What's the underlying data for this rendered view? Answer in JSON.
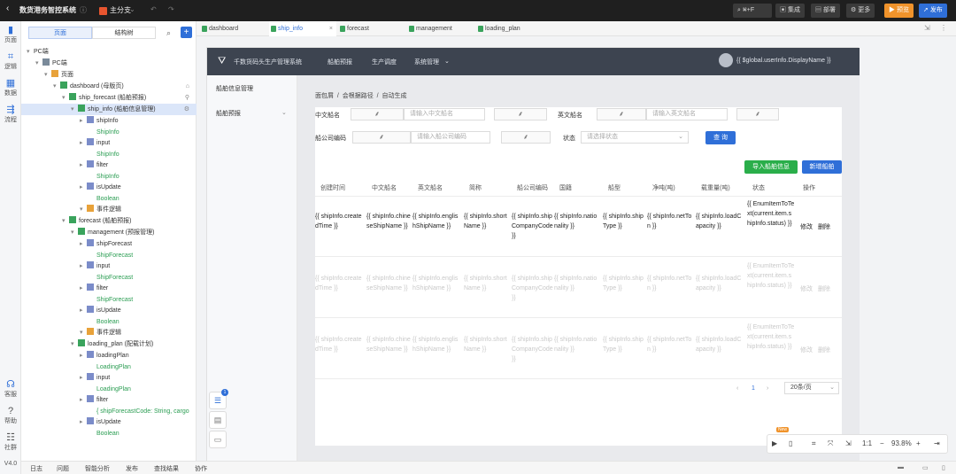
{
  "topbar": {
    "back_icon": "chevron-left-icon",
    "title": "数货港务智控系统",
    "branch_label": "主分支",
    "search_placeholder": "⌘+F",
    "btn_integrate": "集成",
    "btn_deploy": "部署",
    "btn_more": "更多",
    "btn_preview": "预览",
    "btn_publish": "发布"
  },
  "rail": {
    "items": [
      {
        "label": "页面",
        "icon": "page-icon"
      },
      {
        "label": "逻辑",
        "icon": "logic-icon"
      },
      {
        "label": "数据",
        "icon": "data-icon"
      },
      {
        "label": "流程",
        "icon": "flow-icon"
      }
    ],
    "bottom": [
      {
        "label": "客服",
        "icon": "support-icon"
      },
      {
        "label": "帮助",
        "icon": "help-icon"
      },
      {
        "label": "社群",
        "icon": "community-icon"
      }
    ],
    "version": "V4.0"
  },
  "tree": {
    "tab_pages": "页面",
    "tab_structure": "结构树",
    "nodes": [
      {
        "label": "PC端",
        "sub": "",
        "indent": 0,
        "kind": "none",
        "sel": false
      },
      {
        "label": "PC端",
        "sub": "",
        "indent": 1,
        "kind": "monitor",
        "sel": false
      },
      {
        "label": "页面",
        "sub": "",
        "indent": 2,
        "kind": "folder",
        "sel": false
      },
      {
        "label": "dashboard (母版页)",
        "sub": "",
        "indent": 3,
        "kind": "page",
        "sel": false
      },
      {
        "label": "ship_forecast (船舶预报)",
        "sub": "",
        "indent": 4,
        "kind": "page",
        "sel": false
      },
      {
        "label": "ship_info (船舶信息管理)",
        "sub": "",
        "indent": 5,
        "kind": "page",
        "sel": true
      },
      {
        "label": "shipInfo",
        "sub": "ShipInfo",
        "indent": 6,
        "kind": "var",
        "sel": false
      },
      {
        "label": "input",
        "sub": "ShipInfo",
        "indent": 6,
        "kind": "var",
        "sel": false
      },
      {
        "label": "filter",
        "sub": "ShipInfo",
        "indent": 6,
        "kind": "var",
        "sel": false
      },
      {
        "label": "isUpdate",
        "sub": "Boolean",
        "indent": 6,
        "kind": "var",
        "sel": false
      },
      {
        "label": "事件逻辑",
        "sub": "",
        "indent": 6,
        "kind": "folder",
        "sel": false
      },
      {
        "label": "forecast (船舶预报)",
        "sub": "",
        "indent": 4,
        "kind": "page",
        "sel": false
      },
      {
        "label": "management (预报管理)",
        "sub": "",
        "indent": 5,
        "kind": "page",
        "sel": false
      },
      {
        "label": "shipForecast",
        "sub": "ShipForecast",
        "indent": 6,
        "kind": "var",
        "sel": false
      },
      {
        "label": "input",
        "sub": "ShipForecast",
        "indent": 6,
        "kind": "var",
        "sel": false
      },
      {
        "label": "filter",
        "sub": "ShipForecast",
        "indent": 6,
        "kind": "var",
        "sel": false
      },
      {
        "label": "isUpdate",
        "sub": "Boolean",
        "indent": 6,
        "kind": "var",
        "sel": false
      },
      {
        "label": "事件逻辑",
        "sub": "",
        "indent": 6,
        "kind": "folder",
        "sel": false
      },
      {
        "label": "loading_plan (配载计划)",
        "sub": "",
        "indent": 5,
        "kind": "page",
        "sel": false
      },
      {
        "label": "loadingPlan",
        "sub": "LoadingPlan",
        "indent": 6,
        "kind": "var",
        "sel": false
      },
      {
        "label": "input",
        "sub": "LoadingPlan",
        "indent": 6,
        "kind": "var",
        "sel": false
      },
      {
        "label": "filter",
        "sub": "{ shipForecastCode: String, cargo",
        "indent": 6,
        "kind": "var",
        "sel": false
      },
      {
        "label": "isUpdate",
        "sub": "Boolean",
        "indent": 6,
        "kind": "var",
        "sel": false
      }
    ]
  },
  "editor_tabs": [
    {
      "label": "dashboard",
      "active": false
    },
    {
      "label": "ship_info",
      "active": true
    },
    {
      "label": "forecast",
      "active": false
    },
    {
      "label": "management",
      "active": false
    },
    {
      "label": "loading_plan",
      "active": false
    }
  ],
  "app": {
    "system_name": "千数货码头生产管理系统",
    "nav": [
      "船舶预报",
      "生产调度",
      "系统管理"
    ],
    "user": "{{ $global.userInfo.DisplayName }}",
    "side_items": [
      "船舶信息管理",
      "船舶预报"
    ],
    "breadcrumb": [
      "面包屑",
      "/",
      "会根据路径",
      "/",
      "自动生成"
    ],
    "form": {
      "cn_name_label": "中文船名",
      "cn_name_placeholder": "请输入中文船名",
      "en_name_label": "英文船名",
      "en_name_placeholder": "请输入英文船名",
      "code_label": "船公司编码",
      "code_placeholder": "请输入船公司编码",
      "status_label": "状态",
      "status_placeholder": "请选择状态",
      "query_btn": "查 询",
      "import_btn": "导入船舶信息",
      "add_btn": "新增船舶"
    },
    "table": {
      "headers": [
        "创建时间",
        "中文船名",
        "英文船名",
        "简称",
        "船公司编码",
        "国籍",
        "船型",
        "净吨(吨)",
        "载重量(吨)",
        "状态",
        "操作"
      ],
      "row": [
        "{{ shipInfo.createdTime }}",
        "{{ shipInfo.chineseShipName }}",
        "{{ shipInfo.englishShipName }}",
        "{{ shipInfo.shortName }}",
        "{{ shipInfo.shipCompanyCode }}",
        "{{ shipInfo.nationality }}",
        "{{ shipInfo.shipType }}",
        "{{ shipInfo.netTon }}",
        "{{ shipInfo.loadCapacity }}",
        "{{ EnumItemToText(current.item.shipInfo.status) }}"
      ],
      "edit": "修改",
      "delete": "删除"
    },
    "pagination": {
      "page": "1",
      "page_size": "20条/页"
    }
  },
  "zoom": {
    "level": "93.8%",
    "ratio": "1:1",
    "badge": "New"
  },
  "bottom_tabs": [
    "日志",
    "问题",
    "智能分析",
    "发布",
    "查找结果",
    "协作"
  ],
  "colors": {
    "accent": "#2f6fd8",
    "green": "#2aae4a",
    "preview": "#f0932b"
  }
}
